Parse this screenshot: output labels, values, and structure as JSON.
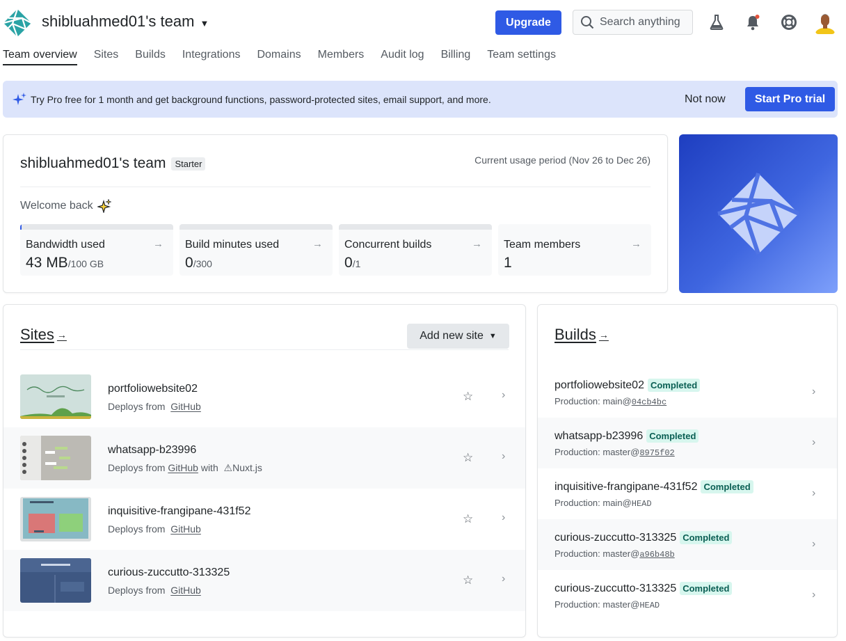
{
  "header": {
    "team_name": "shibluahmed01's team",
    "upgrade_label": "Upgrade",
    "search_placeholder": "Search anything"
  },
  "nav": {
    "items": [
      "Team overview",
      "Sites",
      "Builds",
      "Integrations",
      "Domains",
      "Members",
      "Audit log",
      "Billing",
      "Team settings"
    ],
    "active": "Team overview"
  },
  "promo": {
    "text": "Try Pro free for 1 month and get background functions, password-protected sites, email support, and more.",
    "not_now_label": "Not now",
    "start_trial_label": "Start Pro trial"
  },
  "team_card": {
    "title": "shibluahmed01's team",
    "plan_badge": "Starter",
    "usage_period": "Current usage period (Nov 26 to Dec 26)",
    "welcome": "Welcome back",
    "stats": [
      {
        "label": "Bandwidth used",
        "value": "43 MB",
        "limit": "/100 GB",
        "usage_fraction": 0.0004
      },
      {
        "label": "Build minutes used",
        "value": "0",
        "limit": "/300",
        "usage_fraction": 0
      },
      {
        "label": "Concurrent builds",
        "value": "0",
        "limit": "/1",
        "usage_fraction": 0
      },
      {
        "label": "Team members",
        "value": "1",
        "limit": ""
      }
    ]
  },
  "sites": {
    "title": "Sites",
    "add_label": "Add new site",
    "items": [
      {
        "name": "portfoliowebsite02",
        "deploy_prefix": "Deploys from",
        "deploy_source": "GitHub",
        "framework": ""
      },
      {
        "name": "whatsapp-b23996",
        "deploy_prefix": "Deploys from",
        "deploy_source": "GitHub",
        "framework_prefix": "with",
        "framework": "Nuxt.js"
      },
      {
        "name": "inquisitive-frangipane-431f52",
        "deploy_prefix": "Deploys from",
        "deploy_source": "GitHub",
        "framework": ""
      },
      {
        "name": "curious-zuccutto-313325",
        "deploy_prefix": "Deploys from",
        "deploy_source": "GitHub",
        "framework": ""
      }
    ]
  },
  "builds": {
    "title": "Builds",
    "items": [
      {
        "name": "portfoliowebsite02",
        "status": "Completed",
        "prefix": "Production: main@",
        "ref": "04cb4bc"
      },
      {
        "name": "whatsapp-b23996",
        "status": "Completed",
        "prefix": "Production: master@",
        "ref": "8975f02"
      },
      {
        "name": "inquisitive-frangipane-431f52",
        "status": "Completed",
        "prefix": "Production: main@",
        "ref": "HEAD"
      },
      {
        "name": "curious-zuccutto-313325",
        "status": "Completed",
        "prefix": "Production: master@",
        "ref": "a96b48b"
      },
      {
        "name": "curious-zuccutto-313325",
        "status": "Completed",
        "prefix": "Production: master@",
        "ref": "HEAD"
      }
    ]
  },
  "colors": {
    "accent": "#2f5ae5",
    "promo_bg": "#dce4fb",
    "completed_text": "#0b5f54",
    "completed_bg": "#d7f6ee"
  }
}
